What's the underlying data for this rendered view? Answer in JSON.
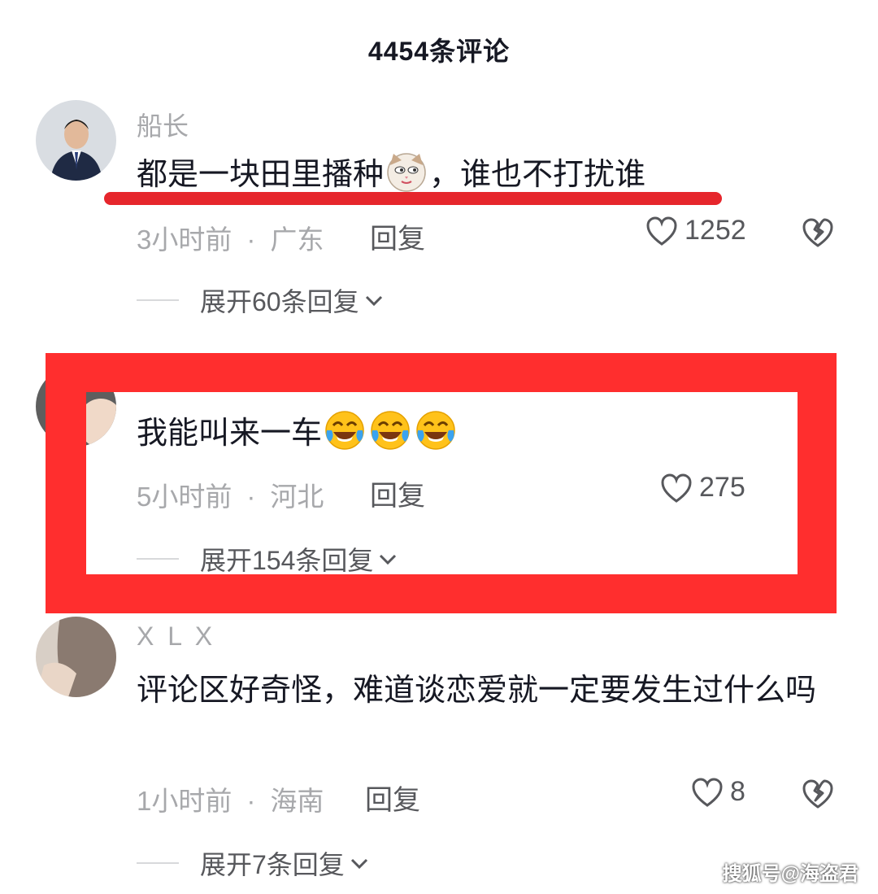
{
  "header": {
    "title": "4454条评论"
  },
  "comments": [
    {
      "username": "船长",
      "text_before": "都是一块田里播种",
      "text_after": "，谁也不打扰谁",
      "time": "3小时前",
      "location": "广东",
      "reply_label": "回复",
      "likes": "1252",
      "expand_label": "展开60条回复"
    },
    {
      "username": "",
      "text": "我能叫来一车",
      "time": "5小时前",
      "location": "河北",
      "reply_label": "回复",
      "likes": "275",
      "expand_label": "展开154条回复"
    },
    {
      "username": "X  L  X",
      "text": "评论区好奇怪，难道谈恋爱就一定要发生过什么吗",
      "time": "1小时前",
      "location": "海南",
      "reply_label": "回复",
      "likes": "8",
      "expand_label": "展开7条回复"
    }
  ],
  "watermark": "搜狐号@海盗君",
  "colors": {
    "highlight": "#ff2e2e",
    "muted": "#a7a8ab",
    "text": "#161823"
  }
}
